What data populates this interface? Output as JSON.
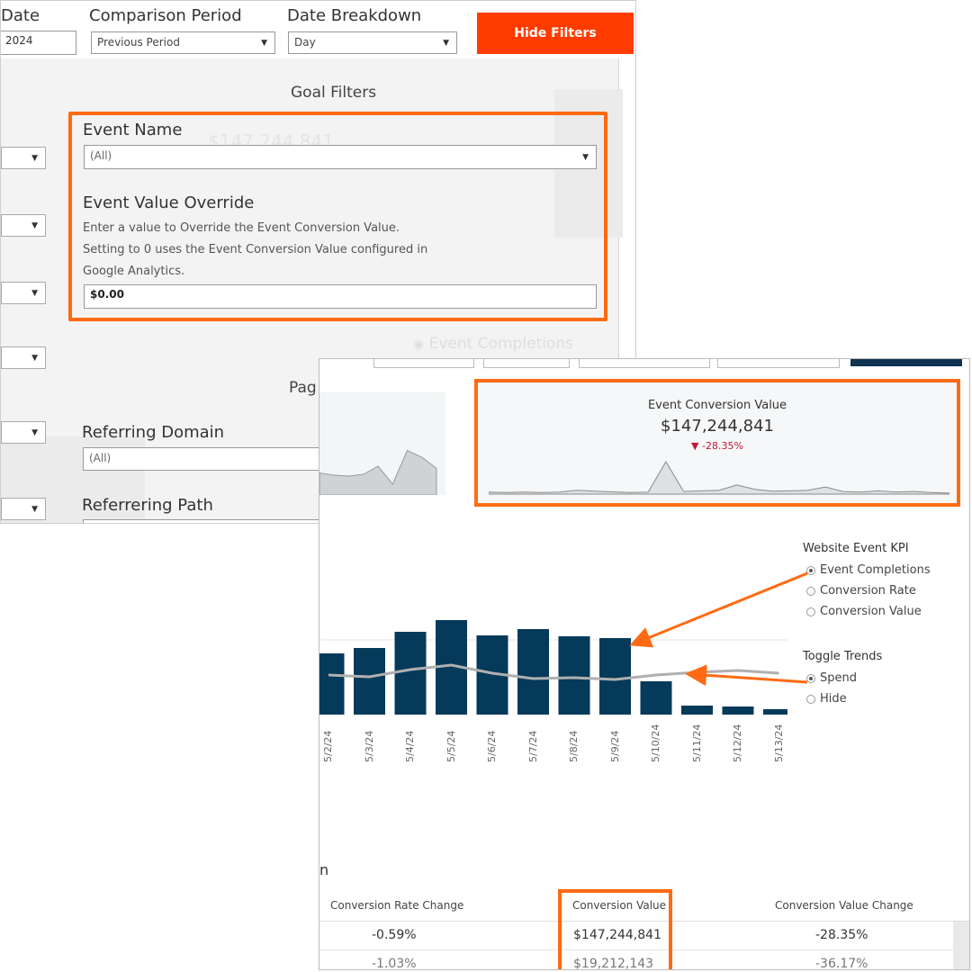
{
  "colors": {
    "accent": "#ff6a13",
    "hide_btn": "#ff3b00",
    "bar": "#063a5a",
    "trend": "#b0b0b0",
    "negative": "#c1173a"
  },
  "panel_a": {
    "header": {
      "date_label": "Date",
      "date_value": "2024",
      "comparison_label": "Comparison Period",
      "comparison_value": "Previous Period",
      "breakdown_label": "Date Breakdown",
      "breakdown_value": "Day",
      "hide_filters": "Hide Filters"
    },
    "goal_filters": {
      "title": "Goal Filters",
      "ghost_value": "$147,244,841",
      "event_name_label": "Event Name",
      "event_name_value": "(All)",
      "override_label": "Event Value Override",
      "help_line1": "Enter a value to Override the Event Conversion Value.",
      "help_line2": "Setting to 0 uses the Event Conversion Value configured in",
      "help_line3": "Google Analytics.",
      "override_value": "$0.00"
    },
    "ghost_radio": "Event Completions",
    "page_section_title": "Pag",
    "referring_domain_label": "Referring Domain",
    "referring_domain_value": "(All)",
    "referring_path_label": "Referrering Path"
  },
  "panel_b": {
    "kpi": {
      "title": "Event Conversion Value",
      "value": "$147,244,841",
      "change": "-28.35%",
      "change_arrow": "▼",
      "sparkline": [
        0.06,
        0.05,
        0.06,
        0.05,
        0.06,
        0.12,
        0.09,
        0.07,
        0.05,
        0.06,
        1.0,
        0.08,
        0.1,
        0.12,
        0.28,
        0.15,
        0.09,
        0.1,
        0.12,
        0.22,
        0.08,
        0.06,
        0.1,
        0.06,
        0.08,
        0.05,
        0.03
      ]
    },
    "left_sparkline": [
      0.45,
      0.4,
      0.38,
      0.42,
      0.6,
      0.2,
      0.95,
      0.8,
      0.55
    ],
    "website_kpi": {
      "title": "Website Event KPI",
      "options": [
        "Event Completions",
        "Conversion Rate",
        "Conversion Value"
      ],
      "selected": 0
    },
    "toggle_trends": {
      "title": "Toggle Trends",
      "options": [
        "Spend",
        "Hide"
      ],
      "selected": 0
    },
    "chart_data": {
      "type": "bar",
      "categories": [
        "5/2/24",
        "5/3/24",
        "5/4/24",
        "5/5/24",
        "5/6/24",
        "5/7/24",
        "5/8/24",
        "5/9/24",
        "5/10/24",
        "5/11/24",
        "5/12/24",
        "5/13/24"
      ],
      "series": [
        {
          "values": [
            68,
            74,
            92,
            105,
            88,
            95,
            87,
            85,
            37,
            10,
            9,
            6
          ]
        },
        {
          "values": [
            44,
            42,
            50,
            55,
            46,
            40,
            41,
            39,
            44,
            47,
            49,
            46
          ]
        }
      ]
    },
    "table": {
      "section_letter": "n",
      "headers": [
        "Conversion Rate Change",
        "Conversion Value",
        "Conversion Value Change"
      ],
      "rows": [
        [
          "-0.59%",
          "$147,244,841",
          "-28.35%"
        ],
        [
          "-1.03%",
          "$19,212,143",
          "-36.17%"
        ]
      ]
    }
  }
}
